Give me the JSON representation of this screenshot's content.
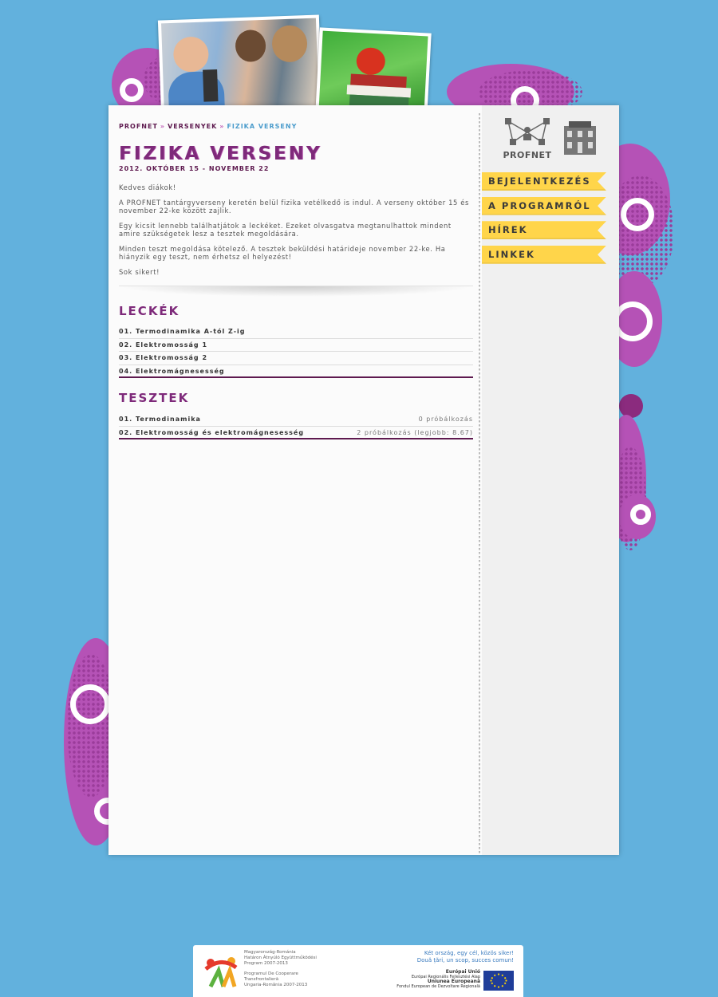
{
  "breadcrumb": {
    "items": [
      "PROFNET",
      "VERSENYEK"
    ],
    "current": "FIZIKA VERSENY",
    "separator": "»"
  },
  "page": {
    "title": "FIZIKA VERSENY",
    "date": "2012. OKTÓBER 15 - NOVEMBER 22",
    "intro": [
      "Kedves diákok!",
      "A PROFNET tantárgyverseny keretén belül fizika vetélkedő is indul. A verseny október 15 és november 22-ke között zajlik.",
      "Egy kicsit lennebb találhatjátok a leckéket. Ezeket olvasgatva megtanulhattok mindent amire szükségetek lesz a tesztek megoldására.",
      "Minden teszt megoldása kötelező. A tesztek beküldési határideje november 22-ke. Ha hiányzik egy teszt, nem érhetsz el helyezést!",
      "Sok sikert!"
    ]
  },
  "lessons": {
    "heading": "LECKÉK",
    "items": [
      "01. Termodinamika A-tól Z-ig",
      "02. Elektromosság 1",
      "03. Elektromosság 2",
      "04. Elektromágnesesség"
    ]
  },
  "tests": {
    "heading": "TESZTEK",
    "items": [
      {
        "name": "01. Termodinamika",
        "attempts": "0 próbálkozás"
      },
      {
        "name": "02. Elektromosság és elektromágnesesség",
        "attempts": "2 próbálkozás (legjobb: 8.67)"
      }
    ]
  },
  "sidebar": {
    "logo_text": "PROFNET",
    "menu": [
      "BEJELENTKEZÉS",
      "A PROGRAMRÓL",
      "HÍREK",
      "LINKEK"
    ]
  },
  "footer": {
    "program_hu": [
      "Magyarország-Románia",
      "Határon Átnyúló Együttműködési",
      "Program 2007-2013"
    ],
    "program_ro": [
      "Programul De Cooperare",
      "Transfrontalieră",
      "Ungaria-România 2007-2013"
    ],
    "slogan": [
      "Két ország, egy cél, közös siker!",
      "Două țări, un scop, succes comun!"
    ],
    "eu": {
      "hu_title": "Európai Unió",
      "hu_fund": "Európai Regionális Fejlesztési Alap",
      "ro_title": "Uniunea Europeană",
      "ro_fund": "Fondul European de Dezvoltare Regională"
    }
  },
  "colors": {
    "background": "#62b1dd",
    "accent": "#7e2a7a",
    "menu": "#ffd54a",
    "blob": "#b552b6"
  }
}
